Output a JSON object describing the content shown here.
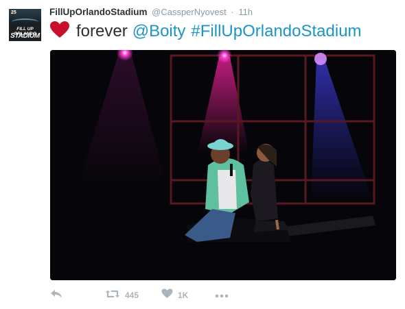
{
  "tweet": {
    "account_name": "FillUpOrlandoStadium",
    "handle": "@CassperNyovest",
    "separator": "·",
    "time": "11h",
    "avatar_text": {
      "badge": "25",
      "line1": "FILL UP ORLANDO",
      "line2": "STADIUM"
    },
    "text": {
      "emoji": "heart-emoji",
      "word": "forever",
      "mention": "@Boity",
      "hashtag": "#FillUpOrlandoStadium"
    },
    "colors": {
      "link": "#1b95c8",
      "heart": "#c8102e",
      "meta": "#8899a6",
      "action": "#a9b6bf"
    }
  },
  "actions": {
    "reply_icon": "reply-icon",
    "retweet_icon": "retweet-icon",
    "retweet_count": "445",
    "like_icon": "heart-icon",
    "like_count": "1K",
    "more_icon": "more-dots-icon"
  }
}
